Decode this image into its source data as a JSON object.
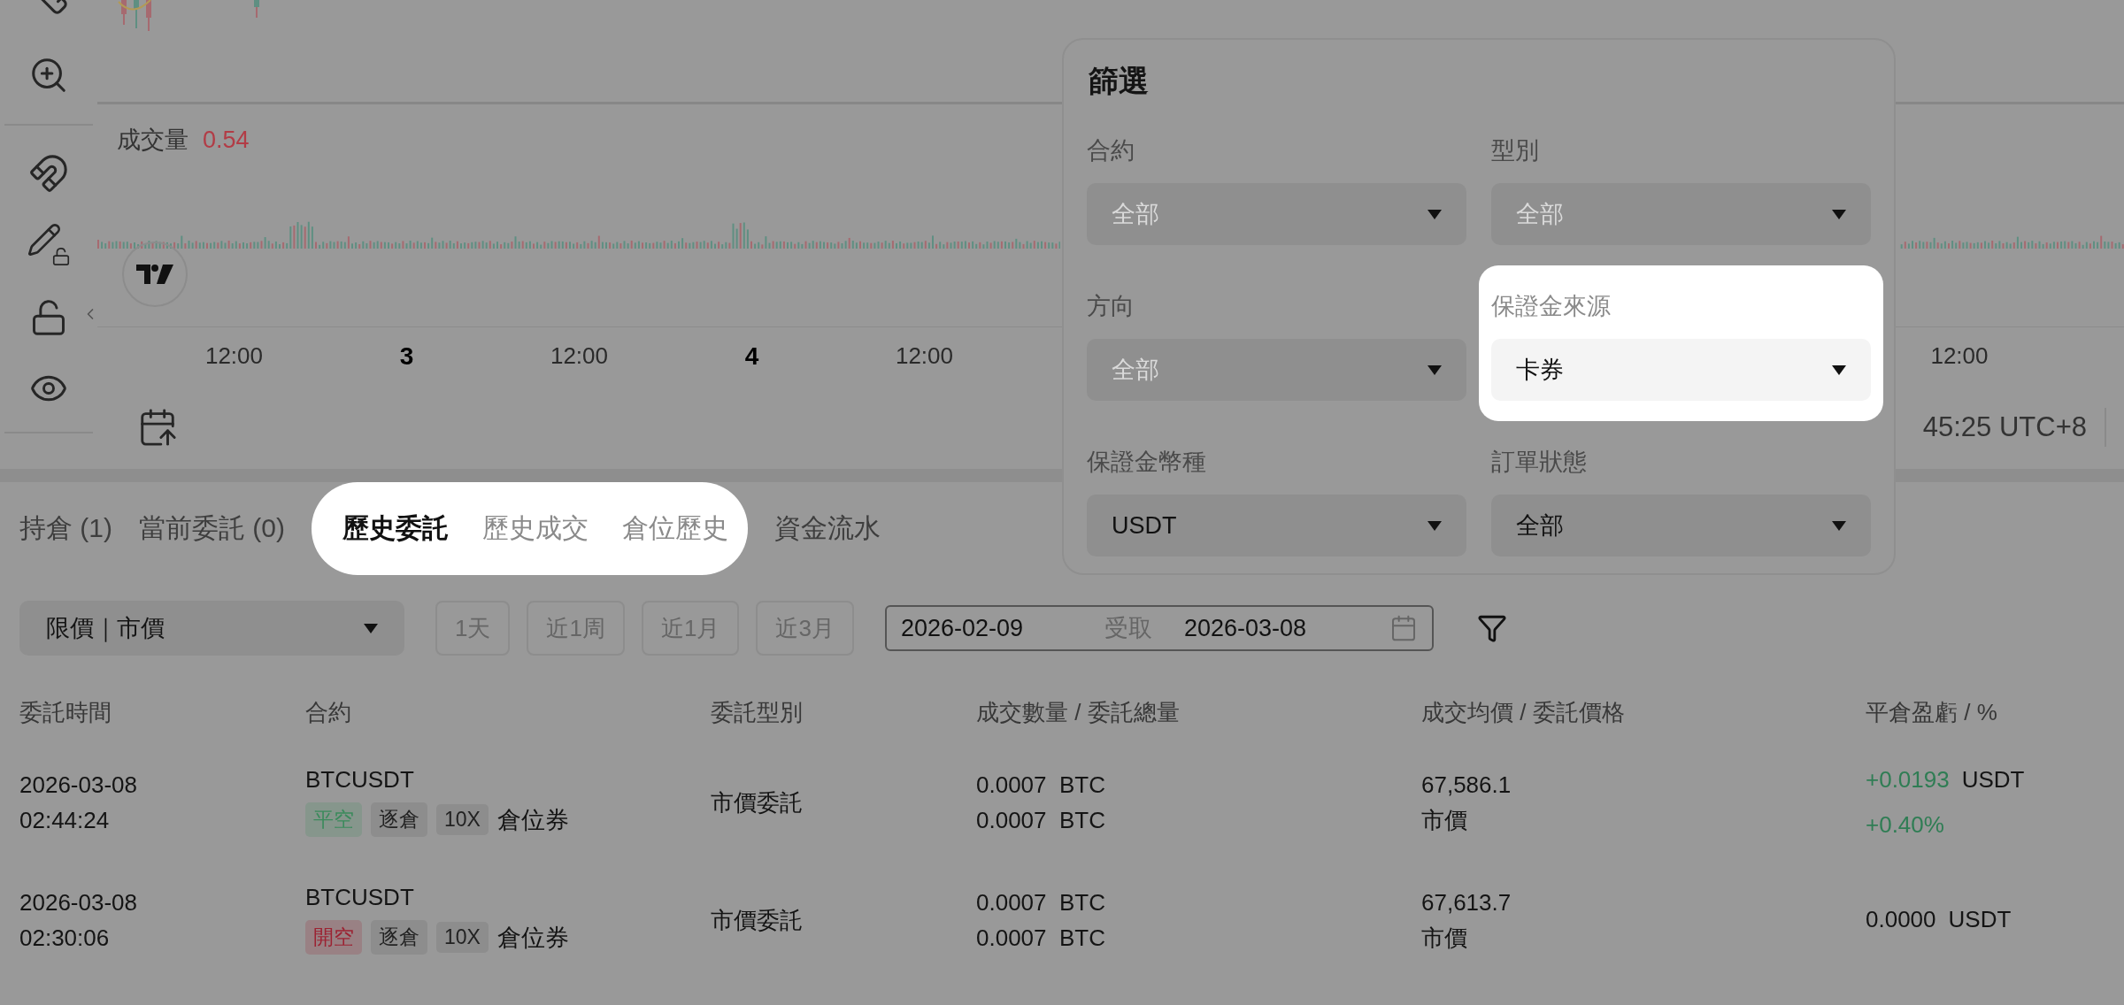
{
  "chart": {
    "volume_label": "成交量",
    "volume_value": "0.54",
    "time_axis_left": [
      {
        "label": "12:00",
        "kind": "time"
      },
      {
        "label": "3",
        "kind": "day"
      },
      {
        "label": "12:00",
        "kind": "time"
      },
      {
        "label": "4",
        "kind": "day"
      },
      {
        "label": "12:00",
        "kind": "time"
      }
    ],
    "time_axis_right": [
      "12:00"
    ],
    "clock": "45:25 UTC+8"
  },
  "filter_panel": {
    "title": "篩選",
    "fields": [
      {
        "label": "合約",
        "value": "全部",
        "disabled": true,
        "highlighted": false
      },
      {
        "label": "型別",
        "value": "全部",
        "disabled": true,
        "highlighted": false
      },
      {
        "label": "方向",
        "value": "全部",
        "disabled": true,
        "highlighted": false
      },
      {
        "label": "保證金來源",
        "value": "卡券",
        "disabled": false,
        "highlighted": true
      },
      {
        "label": "保證金幣種",
        "value": "USDT",
        "disabled": false,
        "highlighted": false
      },
      {
        "label": "訂單狀態",
        "value": "全部",
        "disabled": false,
        "highlighted": false
      }
    ]
  },
  "tabs": [
    {
      "label": "持倉 (1)",
      "selected": false,
      "highlighted": false
    },
    {
      "label": "當前委託 (0)",
      "selected": false,
      "highlighted": false
    },
    {
      "label": "歷史委託",
      "selected": true,
      "highlighted": true
    },
    {
      "label": "歷史成交",
      "selected": false,
      "highlighted": true
    },
    {
      "label": "倉位歷史",
      "selected": false,
      "highlighted": true
    },
    {
      "label": "資金流水",
      "selected": false,
      "highlighted": false
    }
  ],
  "filters": {
    "order_type": "限價｜市價",
    "ranges": [
      {
        "label": "1天",
        "selected": false
      },
      {
        "label": "近1周",
        "selected": false
      },
      {
        "label": "近1月",
        "selected": false
      },
      {
        "label": "近3月",
        "selected": false
      }
    ],
    "date_range": {
      "start": "2026-02-09",
      "separator": "受取",
      "end": "2026-03-08"
    }
  },
  "table": {
    "columns": [
      "委託時間",
      "合約",
      "委託型別",
      "成交數量 / 委託總量",
      "成交均價 / 委託價格",
      "平倉盈虧 / %"
    ],
    "rows": [
      {
        "date": "2026-03-08",
        "time": "02:44:24",
        "symbol": "BTCUSDT",
        "tags": [
          {
            "text": "平空",
            "kind": "side",
            "color": "#3b8a5c"
          },
          {
            "text": "逐倉",
            "kind": "plain"
          },
          {
            "text": "10X",
            "kind": "plain"
          }
        ],
        "coupon": "倉位券",
        "order_type": "市價委託",
        "filled": "0.0007",
        "filled_unit": "BTC",
        "total": "0.0007",
        "total_unit": "BTC",
        "avg_price": "67,586.1",
        "order_price": "市價",
        "pnl": {
          "value": "+0.0193",
          "unit": "USDT",
          "percent": "+0.40%",
          "color": "#2f7d54"
        }
      },
      {
        "date": "2026-03-08",
        "time": "02:30:06",
        "symbol": "BTCUSDT",
        "tags": [
          {
            "text": "開空",
            "kind": "side",
            "color": "#9c2232"
          },
          {
            "text": "逐倉",
            "kind": "plain"
          },
          {
            "text": "10X",
            "kind": "plain"
          }
        ],
        "coupon": "倉位券",
        "order_type": "市價委託",
        "filled": "0.0007",
        "filled_unit": "BTC",
        "total": "0.0007",
        "total_unit": "BTC",
        "avg_price": "67,613.7",
        "order_price": "市價",
        "pnl": {
          "value": "0.0000",
          "unit": "USDT"
        }
      }
    ]
  }
}
